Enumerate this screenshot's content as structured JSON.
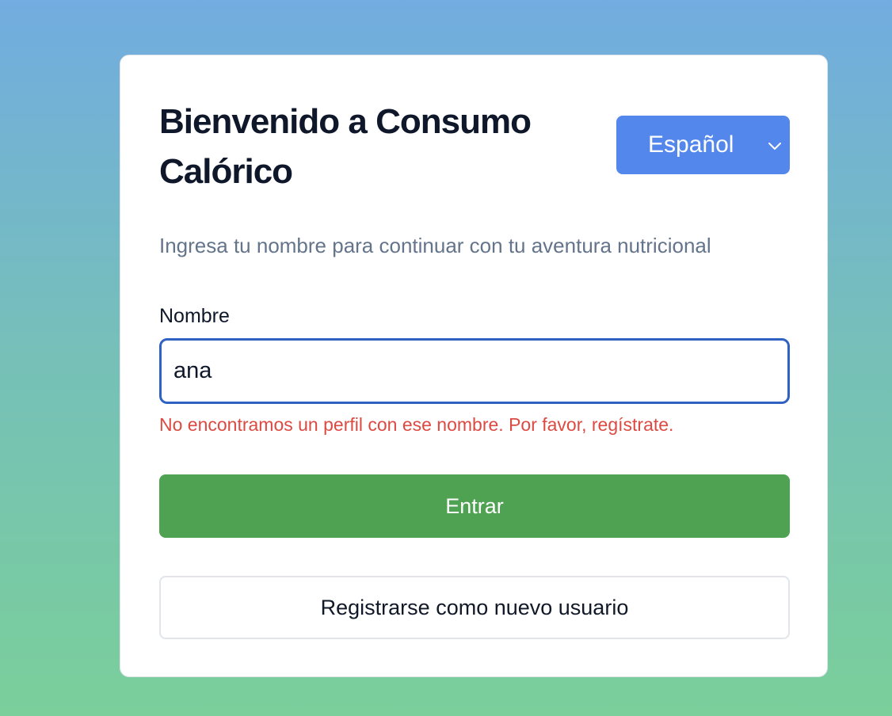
{
  "card": {
    "title": "Bienvenido a Consumo Calórico",
    "subtitle": "Ingresa tu nombre para continuar con tu aventura nutricional"
  },
  "language_select": {
    "selected": "Español",
    "icon": "chevron-down-icon"
  },
  "form": {
    "name_label": "Nombre",
    "name_value": "ana",
    "error": "No encontramos un perfil con ese nombre. Por favor, regístrate."
  },
  "buttons": {
    "login": "Entrar",
    "register": "Registrarse como nuevo usuario"
  },
  "colors": {
    "primary_button": "#50a253",
    "language_select": "#5387ec",
    "error": "#dc4a42",
    "input_focus_border": "#2f62c3"
  }
}
